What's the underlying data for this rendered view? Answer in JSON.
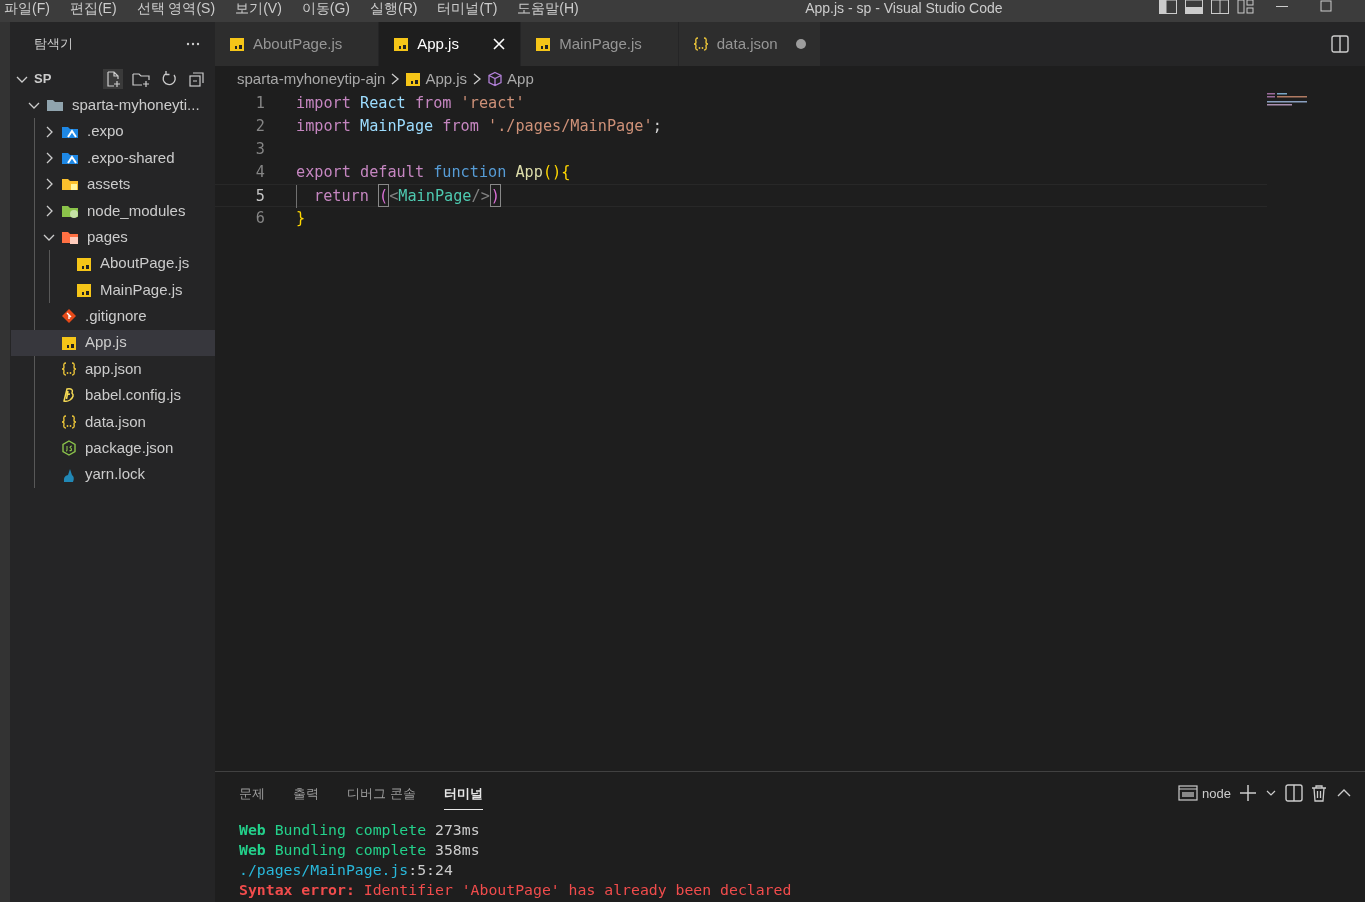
{
  "menu": [
    "파일(F)",
    "편집(E)",
    "선택 영역(S)",
    "보기(V)",
    "이동(G)",
    "실행(R)",
    "터미널(T)",
    "도움말(H)"
  ],
  "window": {
    "title": "App.js - sp - Visual Studio Code"
  },
  "sidebar": {
    "title": "탐색기",
    "section": "SP",
    "tree": [
      {
        "label": "sparta-myhoneyti...",
        "kind": "folder",
        "expanded": true,
        "selected": false,
        "children": [
          {
            "label": ".expo",
            "kind": "folder-expo",
            "expanded": false,
            "selected": false
          },
          {
            "label": ".expo-shared",
            "kind": "folder-expo",
            "expanded": false,
            "selected": false
          },
          {
            "label": "assets",
            "kind": "folder-assets",
            "expanded": false,
            "selected": false
          },
          {
            "label": "node_modules",
            "kind": "folder-node",
            "expanded": false,
            "selected": false
          },
          {
            "label": "pages",
            "kind": "folder-pages",
            "expanded": true,
            "selected": false,
            "children": [
              {
                "label": "AboutPage.js",
                "kind": "js",
                "selected": false
              },
              {
                "label": "MainPage.js",
                "kind": "js",
                "selected": false
              }
            ]
          },
          {
            "label": ".gitignore",
            "kind": "git",
            "selected": false
          },
          {
            "label": "App.js",
            "kind": "js",
            "selected": true
          },
          {
            "label": "app.json",
            "kind": "json",
            "selected": false
          },
          {
            "label": "babel.config.js",
            "kind": "babel",
            "selected": false
          },
          {
            "label": "data.json",
            "kind": "json",
            "selected": false
          },
          {
            "label": "package.json",
            "kind": "nodejs",
            "selected": false
          },
          {
            "label": "yarn.lock",
            "kind": "yarn",
            "selected": false
          }
        ]
      }
    ]
  },
  "tabs": [
    {
      "label": "AboutPage.js",
      "kind": "js",
      "selected": false,
      "modified": false
    },
    {
      "label": "App.js",
      "kind": "js",
      "selected": true,
      "modified": false
    },
    {
      "label": "MainPage.js",
      "kind": "js",
      "selected": false,
      "modified": false
    },
    {
      "label": "data.json",
      "kind": "json",
      "selected": false,
      "modified": true
    }
  ],
  "breadcrumbs": [
    {
      "label": "sparta-myhoneytip-ajn",
      "kind": "text"
    },
    {
      "label": "App.js",
      "kind": "js"
    },
    {
      "label": "App",
      "kind": "component"
    }
  ],
  "code": [
    {
      "number": "1",
      "current": false,
      "tokens": [
        {
          "kind": "keyword",
          "text": "import"
        },
        {
          "kind": "variable",
          "text": " React"
        },
        {
          "kind": "keyword",
          "text": " from"
        },
        {
          "kind": "string",
          "text": " 'react'"
        }
      ]
    },
    {
      "number": "2",
      "current": false,
      "tokens": [
        {
          "kind": "keyword",
          "text": "import"
        },
        {
          "kind": "variable",
          "text": " MainPage"
        },
        {
          "kind": "keyword",
          "text": " from"
        },
        {
          "kind": "string",
          "text": " './pages/MainPage'"
        },
        {
          "kind": "plain",
          "text": ";"
        }
      ]
    },
    {
      "number": "3",
      "current": false
    },
    {
      "number": "4",
      "current": false,
      "tokens": [
        {
          "kind": "keyword",
          "text": "export"
        },
        {
          "kind": "keyword",
          "text": " default"
        },
        {
          "kind": "storage",
          "text": " function"
        },
        {
          "kind": "function",
          "text": " App"
        },
        {
          "kind": "brace",
          "text": "(){"
        }
      ]
    },
    {
      "number": "5",
      "current": true,
      "indent": true,
      "tokens": [
        {
          "kind": "keyword",
          "text": "return "
        },
        {
          "kind": "bracket-match",
          "text": "("
        },
        {
          "kind": "tag-punct",
          "text": "<"
        },
        {
          "kind": "tag",
          "text": "MainPage"
        },
        {
          "kind": "tag-punct",
          "text": "/>"
        },
        {
          "kind": "bracket-match",
          "text": ")"
        }
      ]
    },
    {
      "number": "6",
      "current": false,
      "tokens": [
        {
          "kind": "brace",
          "text": "}"
        }
      ]
    }
  ],
  "panel": {
    "tabs": [
      {
        "label": "문제",
        "selected": false
      },
      {
        "label": "출력",
        "selected": false
      },
      {
        "label": "디버그 콘솔",
        "selected": false
      },
      {
        "label": "터미널",
        "selected": true
      }
    ],
    "terminal_name": "node",
    "lines": [
      [
        {
          "kind": "success-bold",
          "text": "Web"
        },
        {
          "kind": "success",
          "text": " Bundling complete"
        },
        {
          "kind": "plain",
          "text": " 273ms"
        }
      ],
      [
        {
          "kind": "success-bold",
          "text": "Web"
        },
        {
          "kind": "success",
          "text": " Bundling complete"
        },
        {
          "kind": "plain",
          "text": " 358ms"
        }
      ],
      [
        {
          "kind": "path",
          "text": "./pages/MainPage.js"
        },
        {
          "kind": "plain",
          "text": ":5:24"
        }
      ],
      [
        {
          "kind": "error-bold",
          "text": "Syntax error:"
        },
        {
          "kind": "error",
          "text": " Identifier 'AboutPage' has already been declared"
        }
      ]
    ]
  }
}
